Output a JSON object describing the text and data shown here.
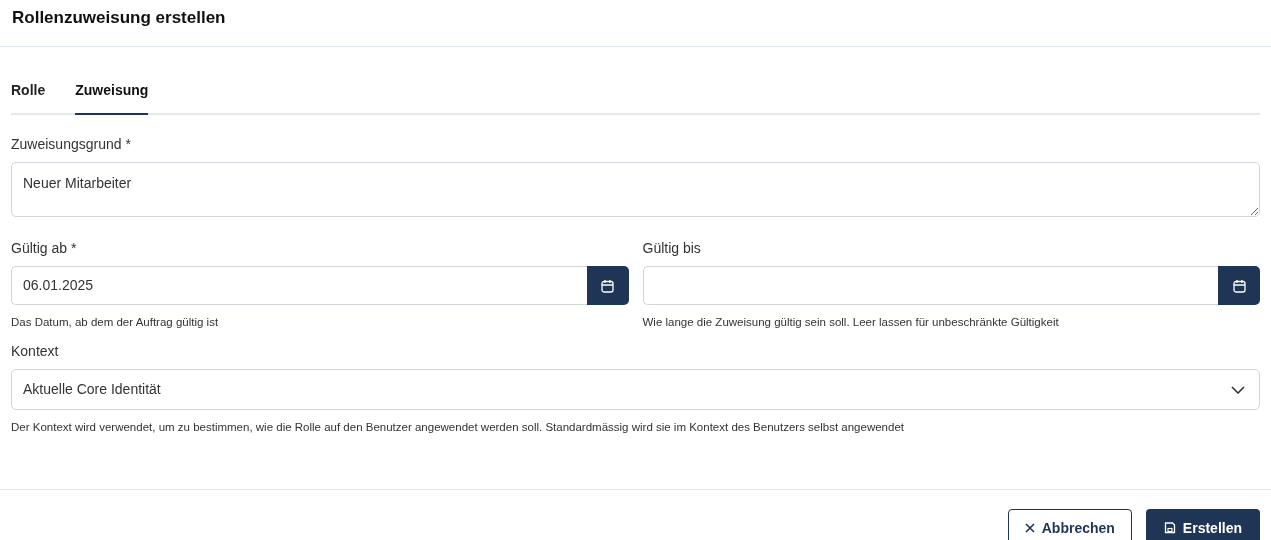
{
  "dialog": {
    "title": "Rollenzuweisung erstellen"
  },
  "tabs": [
    {
      "label": "Rolle",
      "selected": false
    },
    {
      "label": "Zuweisung",
      "selected": true
    }
  ],
  "reason": {
    "label": "Zuweisungsgrund *",
    "value": "Neuer Mitarbeiter"
  },
  "dates": [
    {
      "label": "Gültig ab *",
      "value": "06.01.2025",
      "help": "Das Datum, ab dem der Auftrag gültig ist"
    },
    {
      "label": "Gültig bis",
      "help": "Wie lange die Zuweisung gültig sein soll. Leer lassen für unbeschränkte Gültigkeit"
    }
  ],
  "context": {
    "label": "Kontext",
    "value": "Aktuelle Core Identität",
    "help": "Der Kontext wird verwendet, um zu bestimmen, wie die Rolle auf den Benutzer angewendet werden soll. Standardmässig wird sie im Kontext des Benutzers selbst angewendet"
  },
  "buttons": [
    {
      "label": "Abbrechen",
      "kind": "secondary"
    },
    {
      "label": "Erstellen",
      "kind": "primary"
    }
  ]
}
